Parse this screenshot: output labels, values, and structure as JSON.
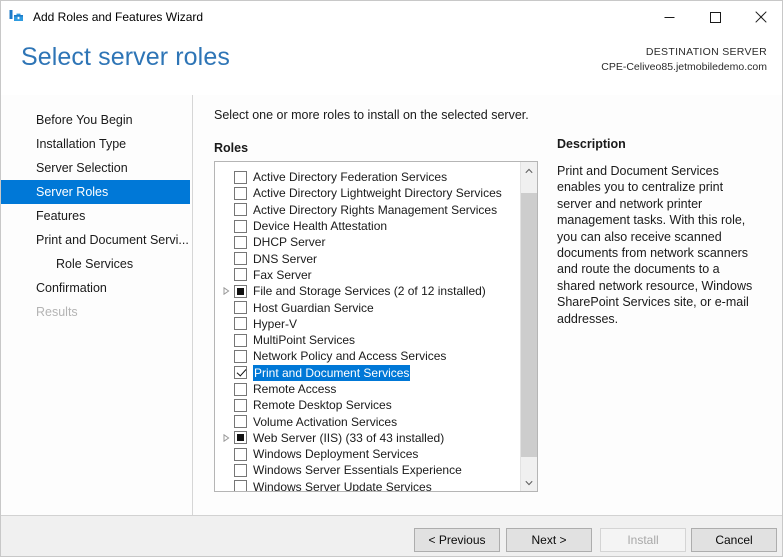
{
  "window": {
    "title": "Add Roles and Features Wizard",
    "icon": "wizard-toolbox-icon",
    "minimize_label": "─",
    "maximize_label": "□",
    "close_label": "✕"
  },
  "header": {
    "page_title": "Select server roles",
    "destination_label": "DESTINATION SERVER",
    "destination_server": "CPE-Celiveo85.jetmobiledemo.com"
  },
  "sidebar": {
    "items": [
      {
        "label": "Before You Begin",
        "state": "normal",
        "indent": 0
      },
      {
        "label": "Installation Type",
        "state": "normal",
        "indent": 0
      },
      {
        "label": "Server Selection",
        "state": "normal",
        "indent": 0
      },
      {
        "label": "Server Roles",
        "state": "selected",
        "indent": 0
      },
      {
        "label": "Features",
        "state": "normal",
        "indent": 0
      },
      {
        "label": "Print and Document Servi...",
        "state": "normal",
        "indent": 0
      },
      {
        "label": "Role Services",
        "state": "normal",
        "indent": 1
      },
      {
        "label": "Confirmation",
        "state": "normal",
        "indent": 0
      },
      {
        "label": "Results",
        "state": "disabled",
        "indent": 0
      }
    ]
  },
  "main": {
    "instruction": "Select one or more roles to install on the selected server.",
    "roles_label": "Roles",
    "roles": [
      {
        "label": "Active Directory Federation Services",
        "check": "unchecked",
        "expander": false
      },
      {
        "label": "Active Directory Lightweight Directory Services",
        "check": "unchecked",
        "expander": false
      },
      {
        "label": "Active Directory Rights Management Services",
        "check": "unchecked",
        "expander": false
      },
      {
        "label": "Device Health Attestation",
        "check": "unchecked",
        "expander": false
      },
      {
        "label": "DHCP Server",
        "check": "unchecked",
        "expander": false
      },
      {
        "label": "DNS Server",
        "check": "unchecked",
        "expander": false
      },
      {
        "label": "Fax Server",
        "check": "unchecked",
        "expander": false
      },
      {
        "label": "File and Storage Services (2 of 12 installed)",
        "check": "partial",
        "expander": true
      },
      {
        "label": "Host Guardian Service",
        "check": "unchecked",
        "expander": false
      },
      {
        "label": "Hyper-V",
        "check": "unchecked",
        "expander": false
      },
      {
        "label": "MultiPoint Services",
        "check": "unchecked",
        "expander": false
      },
      {
        "label": "Network Policy and Access Services",
        "check": "unchecked",
        "expander": false
      },
      {
        "label": "Print and Document Services",
        "check": "checked",
        "expander": false,
        "selected": true
      },
      {
        "label": "Remote Access",
        "check": "unchecked",
        "expander": false
      },
      {
        "label": "Remote Desktop Services",
        "check": "unchecked",
        "expander": false
      },
      {
        "label": "Volume Activation Services",
        "check": "unchecked",
        "expander": false
      },
      {
        "label": "Web Server (IIS) (33 of 43 installed)",
        "check": "partial",
        "expander": true
      },
      {
        "label": "Windows Deployment Services",
        "check": "unchecked",
        "expander": false
      },
      {
        "label": "Windows Server Essentials Experience",
        "check": "unchecked",
        "expander": false
      },
      {
        "label": "Windows Server Update Services",
        "check": "unchecked",
        "expander": false
      }
    ]
  },
  "description": {
    "title": "Description",
    "text": "Print and Document Services enables you to centralize print server and network printer management tasks. With this role, you can also receive scanned documents from network scanners and route the documents to a shared network resource, Windows SharePoint Services site, or e-mail addresses."
  },
  "footer": {
    "previous_label": "< Previous",
    "next_label": "Next >",
    "install_label": "Install",
    "install_disabled": true,
    "cancel_label": "Cancel"
  },
  "colors": {
    "accent": "#0078D7",
    "title_blue": "#2E75B6",
    "footer_bg": "#F0F0F0",
    "scrollbar_thumb": "#CDCDCD"
  }
}
